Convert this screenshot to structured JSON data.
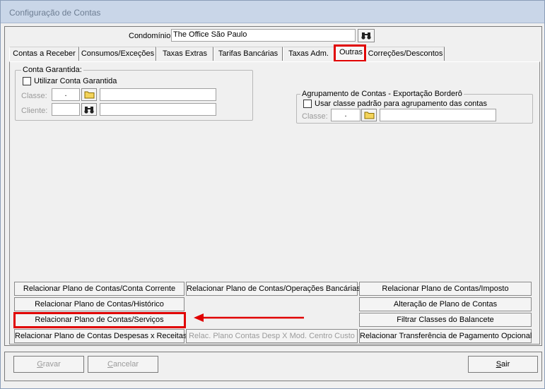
{
  "window": {
    "title": "Configuração de Contas"
  },
  "header": {
    "condominio_label": "Condomínio:",
    "condominio_value": "The Office São Paulo",
    "search_icon": "binoculars-icon"
  },
  "tabs": [
    {
      "label": "Contas a Receber"
    },
    {
      "label": "Consumos/Exceções"
    },
    {
      "label": "Taxas Extras"
    },
    {
      "label": "Tarifas Bancárias"
    },
    {
      "label": "Taxas Adm."
    },
    {
      "label": "Outras"
    },
    {
      "label": "Correções/Descontos"
    }
  ],
  "active_tab": "Outras",
  "conta_garantida": {
    "legend": "Conta Garantida:",
    "checkbox_label": "Utilizar Conta Garantida",
    "checked": false,
    "classe_label": "Classe:",
    "classe_code": ".",
    "cliente_label": "Cliente:",
    "folder_icon": "folder-icon",
    "search_icon": "binoculars-icon"
  },
  "agrupamento": {
    "legend": "Agrupamento de Contas - Exportação Borderô",
    "checkbox_label": "Usar classe padrão para agrupamento das contas",
    "checked": false,
    "classe_label": "Classe:",
    "classe_code": ".",
    "folder_icon": "folder-icon"
  },
  "buttons": {
    "col1": [
      "Relacionar Plano de Contas/Conta Corrente",
      "Relacionar Plano de Contas/Histórico",
      "Relacionar Plano de Contas/Serviços",
      "Relacionar Plano de Contas Despesas x Receitas"
    ],
    "col2": [
      "Relacionar Plano de Contas/Operações Bancárias",
      "Relac. Plano Contas Desp X Mod. Centro Custo"
    ],
    "col3": [
      "Relacionar Plano de Contas/Imposto",
      "Alteração de Plano de Contas",
      "Filtrar Classes do Balancete",
      "Relacionar Transferência de Pagamento Opcional"
    ]
  },
  "footer": {
    "gravar_ul": "G",
    "gravar_rest": "ravar",
    "cancelar_ul": "C",
    "cancelar_rest": "ancelar",
    "sair_ul": "S",
    "sair_rest": "air"
  },
  "colors": {
    "highlight": "#e00000",
    "arrow": "#e00000"
  }
}
